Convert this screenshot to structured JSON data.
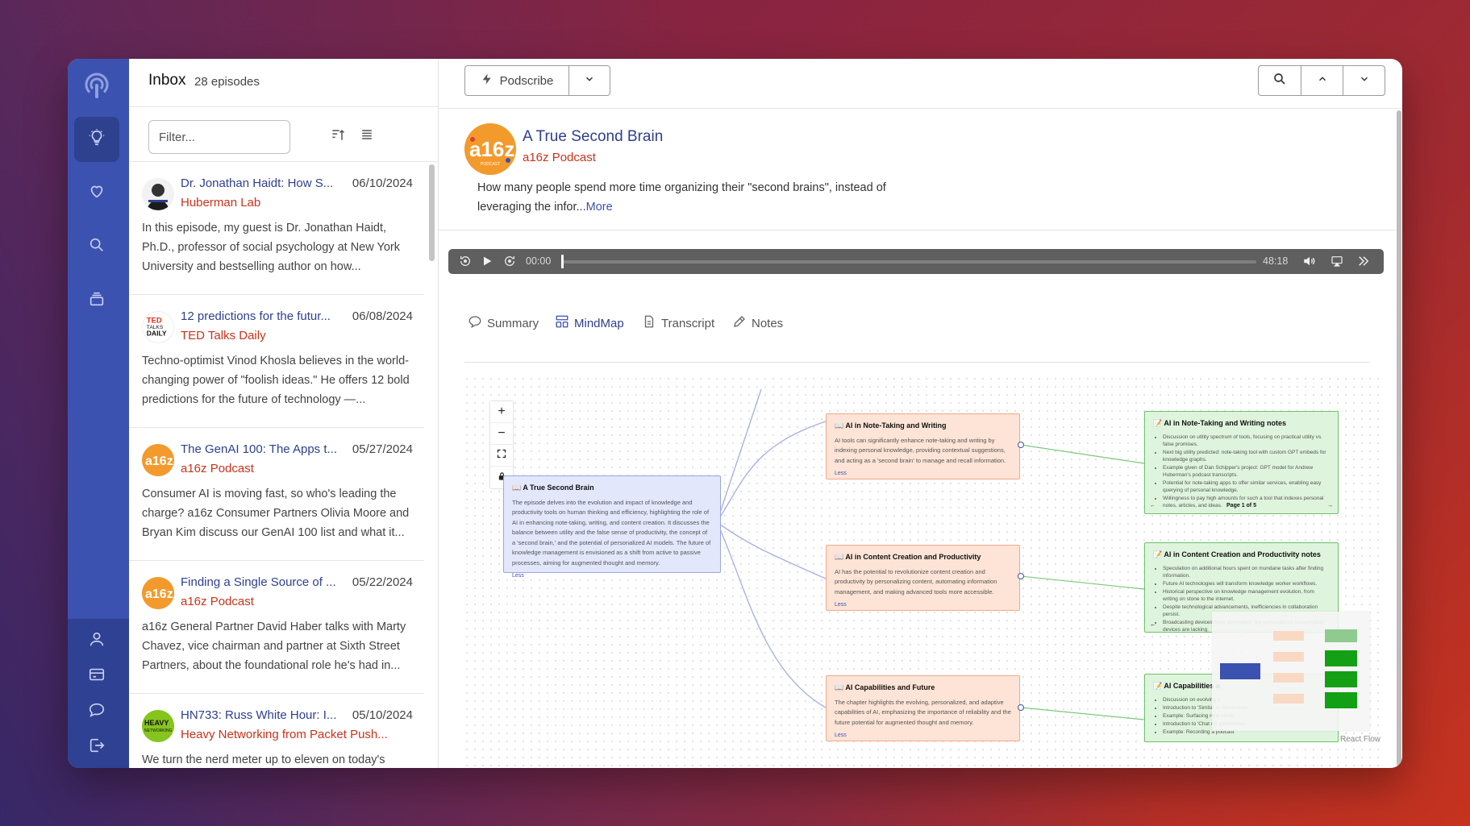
{
  "inbox": {
    "title": "Inbox",
    "count": "28 episodes",
    "filter_placeholder": "Filter..."
  },
  "episodes": [
    {
      "title": "Dr. Jonathan Haidt: How S...",
      "date": "06/10/2024",
      "podcast": "Huberman Lab",
      "desc": "In this episode, my guest is Dr. Jonathan Haidt, Ph.D., professor of social psychology at New York University and bestselling author on how..."
    },
    {
      "title": "12 predictions for the futur...",
      "date": "06/08/2024",
      "podcast": "TED Talks Daily",
      "desc": "Techno-optimist Vinod Khosla believes in the world-changing power of \"foolish ideas.\" He offers 12 bold predictions for the future of technology —..."
    },
    {
      "title": "The GenAI 100: The Apps t...",
      "date": "05/27/2024",
      "podcast": "a16z Podcast",
      "desc": "Consumer AI is moving fast, so who's leading the charge? a16z Consumer Partners Olivia Moore and Bryan Kim discuss our GenAI 100 list and what it..."
    },
    {
      "title": "Finding a Single Source of ...",
      "date": "05/22/2024",
      "podcast": "a16z Podcast",
      "desc": "a16z General Partner David Haber talks with Marty Chavez, vice chairman and partner at Sixth Street Partners, about the foundational role he's had in..."
    },
    {
      "title": "HN733: Russ White Hour: I...",
      "date": "05/10/2024",
      "podcast": "Heavy Networking from Packet Push...",
      "desc": "We turn the nerd meter up to eleven on today's"
    }
  ],
  "toolbar": {
    "podscribe_label": "Podscribe"
  },
  "episode": {
    "title": "A True Second Brain",
    "podcast": "a16z Podcast",
    "desc": "How many people spend more time organizing their \"second brains\", instead of leveraging the infor...",
    "more": "More"
  },
  "player": {
    "current": "00:00",
    "duration": "48:18"
  },
  "tabs": [
    {
      "label": "Summary"
    },
    {
      "label": "MindMap"
    },
    {
      "label": "Transcript"
    },
    {
      "label": "Notes"
    }
  ],
  "mindmap": {
    "root": {
      "title": "A True Second Brain",
      "text": "The episode delves into the evolution and impact of knowledge and productivity tools on human thinking and efficiency, highlighting the role of AI in enhancing note-taking, writing, and content creation. It discusses the balance between utility and the false sense of productivity, the concept of a 'second brain,' and the potential of personalized AI models. The future of knowledge management is envisioned as a shift from active to passive processes, aiming for augmented thought and memory.",
      "less": "Less"
    },
    "topics": [
      {
        "title": "AI in Note-Taking and Writing",
        "text": "AI tools can significantly enhance note-taking and writing by indexing personal knowledge, providing contextual suggestions, and acting as a 'second brain' to manage and recall information.",
        "less": "Less"
      },
      {
        "title": "AI in Content Creation and Productivity",
        "text": "AI has the potential to revolutionize content creation and productivity by personalizing content, automating information management, and making advanced tools more accessible.",
        "less": "Less"
      },
      {
        "title": "AI Capabilities and Future",
        "text": "The chapter highlights the evolving, personalized, and adaptive capabilities of AI, emphasizing the importance of reliability and the future potential for augmented thought and memory.",
        "less": "Less"
      }
    ],
    "notes": [
      {
        "title": "AI in Note-Taking and Writing notes",
        "items": [
          "Discussion on utility spectrum of tools, focusing on practical utility vs. false promises.",
          "Next big utility predicted: note-taking tool with custom GPT embeds for knowledge graphs.",
          "Example given of Dan Schipper's project: GPT model for Andrew Huberman's podcast transcripts.",
          "Potential for note-taking apps to offer similar services, enabling easy querying of personal knowledge.",
          "Willingness to pay high amounts for such a tool that indexes personal notes, articles, and ideas."
        ],
        "page": "Page 1 of 5"
      },
      {
        "title": "AI in Content Creation and Productivity notes",
        "items": [
          "Speculation on additional hours spent on mundane tasks after finding information.",
          "Future AI technologies will transform knowledge worker workflows.",
          "Historical perspective on knowledge management evolution, from writing on stone to the internet.",
          "Despite technological advancements, inefficiencies in collaboration persist.",
          "Broadcasting devices have dominated, but personalized consumption devices are lacking."
        ]
      },
      {
        "title": "AI Capabilities a",
        "items": [
          "Discussion on evolving c",
          "Introduction to 'Similar to documents.",
          "Example: Surfacing relat ideas.",
          "Introduction to 'Chat wit partnership.",
          "Example: Recording a podcast"
        ]
      }
    ],
    "attribution": "React Flow"
  }
}
